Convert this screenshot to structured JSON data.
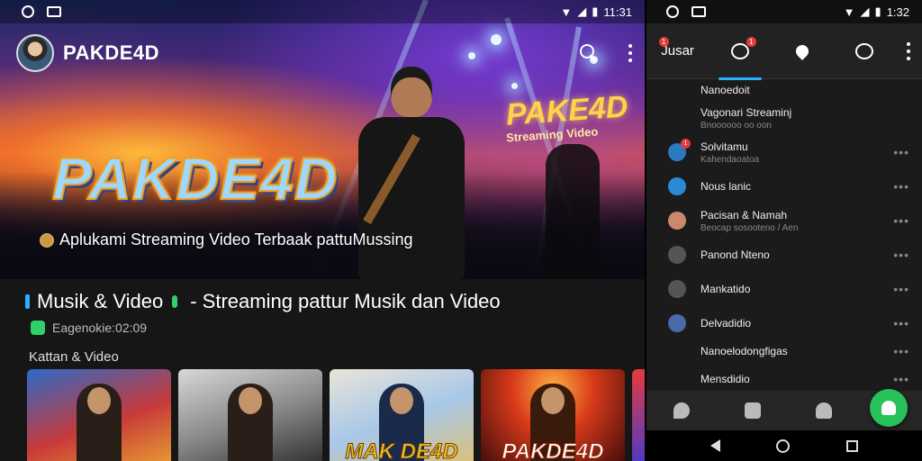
{
  "left": {
    "status": {
      "time": "11:31"
    },
    "header": {
      "title": "PAKDE4D"
    },
    "hero": {
      "logo_text": "PAKDE4D",
      "side_logo_text": "PAKE4D",
      "side_logo_sub": "Streaming Video",
      "caption": "Aplukami Streaming Video Terbaak pattuMussing"
    },
    "section": {
      "title_part1": "Musik & Video",
      "title_part2": "- Streaming pattur Musik dan Video",
      "subtitle": "Eagenokie:02:09",
      "category_label": "Kattan & Video"
    },
    "thumbnails": [
      {
        "title": ""
      },
      {
        "title": ""
      },
      {
        "title": "MAK DE4D"
      },
      {
        "title": "PAKDE4D"
      },
      {
        "title": ""
      }
    ]
  },
  "right": {
    "status": {
      "time": "1:32"
    },
    "tabs": [
      {
        "label": "Jusar",
        "badge": "1",
        "icon": "chat-icon"
      },
      {
        "label": "",
        "badge": "1",
        "icon": "notification-icon"
      },
      {
        "label": "",
        "badge": "",
        "icon": "pin-icon"
      },
      {
        "label": "",
        "badge": "",
        "icon": "message-icon"
      }
    ],
    "list": [
      {
        "main": "Nanoedoit",
        "sub": "",
        "icon": "none",
        "badge": "",
        "color": "#1b1b1b"
      },
      {
        "main": "Vagonari Streaminj",
        "sub": "Bnoooooo oo oon",
        "icon": "none",
        "badge": "",
        "color": "#1b1b1b"
      },
      {
        "main": "Solvitamu",
        "sub": "Kahendaoatoa",
        "icon": "chat-icon",
        "badge": "1",
        "color": "#2a7abf"
      },
      {
        "main": "Nous lanic",
        "sub": "",
        "icon": "info-icon",
        "badge": "",
        "color": "#2a8ad8"
      },
      {
        "main": "Pacisan & Namah",
        "sub": "Beocap sosooteno / Aen",
        "icon": "avatar",
        "badge": "",
        "color": "#c88a6a"
      },
      {
        "main": "Panond Nteno",
        "sub": "",
        "icon": "speech-icon",
        "badge": "",
        "color": "#555555"
      },
      {
        "main": "Mankatido",
        "sub": "",
        "icon": "heart-icon",
        "badge": "",
        "color": "#555555"
      },
      {
        "main": "Delvadidio",
        "sub": "",
        "icon": "avatar",
        "badge": "",
        "color": "#4a6aa8"
      },
      {
        "main": "Nanoelodongfigas",
        "sub": "",
        "icon": "none",
        "badge": "",
        "color": "#1b1b1b"
      },
      {
        "main": "Mensdidio",
        "sub": "",
        "icon": "none",
        "badge": "",
        "color": "#1b1b1b"
      }
    ],
    "bottom_icons": [
      "map-icon",
      "gift-icon",
      "person-icon"
    ],
    "fab_icon": "user-icon"
  }
}
